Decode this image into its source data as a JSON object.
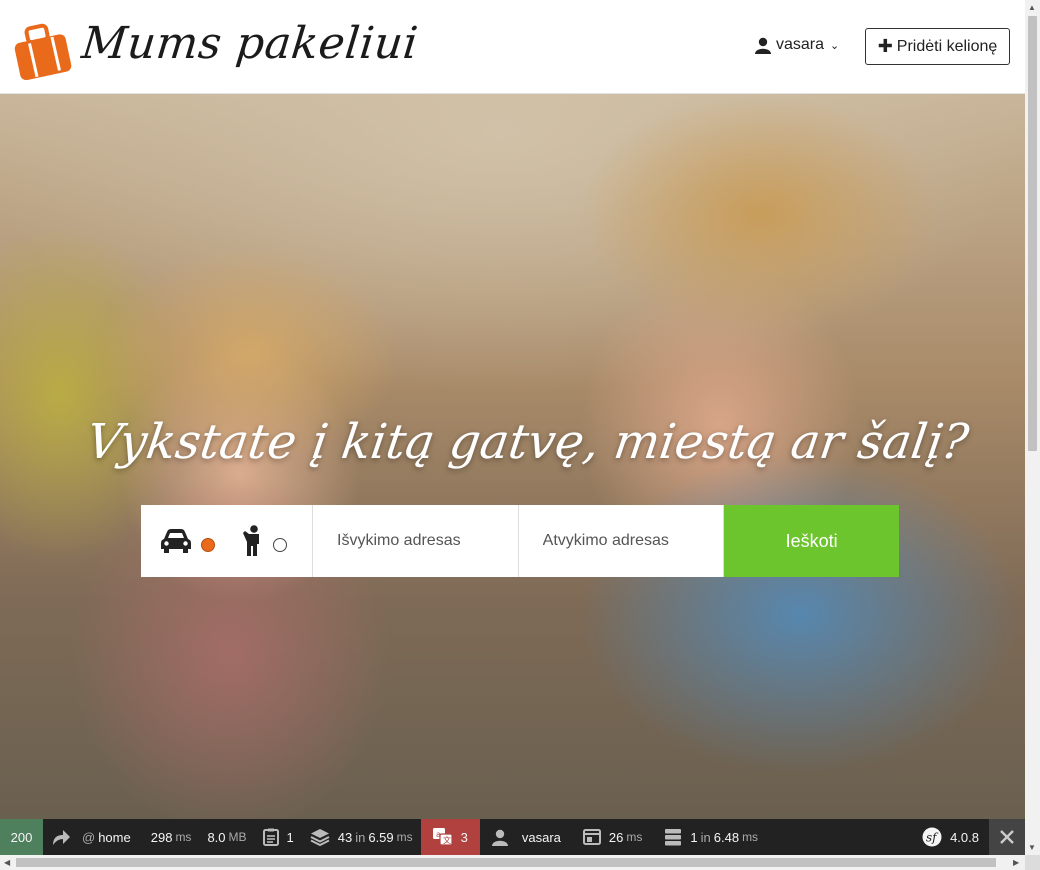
{
  "header": {
    "brand": "Mums pakeliui",
    "user": "vasara",
    "add_trip": "Pridėti kelionę"
  },
  "hero": {
    "title": "Vykstate į kitą gatvę, miestą ar šalį?",
    "modes": [
      {
        "icon": "car-icon",
        "selected": true
      },
      {
        "icon": "passenger-icon",
        "selected": false
      }
    ],
    "from_placeholder": "Išvykimo adresas",
    "to_placeholder": "Atvykimo adresas",
    "search_label": "Ieškoti"
  },
  "toolbar": {
    "status": "200",
    "route_prefix": "@",
    "route": "home",
    "time_value": "298",
    "time_unit": "ms",
    "memory_value": "8.0",
    "memory_unit": "MB",
    "logs": "1",
    "cache_count": "43",
    "cache_in": "in",
    "cache_time": "6.59",
    "cache_unit": "ms",
    "translations": "3",
    "user": "vasara",
    "twig_time": "26",
    "twig_unit": "ms",
    "db_count": "1",
    "db_in": "in",
    "db_time": "6.48",
    "db_unit": "ms",
    "version": "4.0.8"
  },
  "colors": {
    "accent_orange": "#ea6a1c",
    "search_green": "#6cc52c",
    "status_green": "#4f805d",
    "translation_red": "#b0413e"
  }
}
